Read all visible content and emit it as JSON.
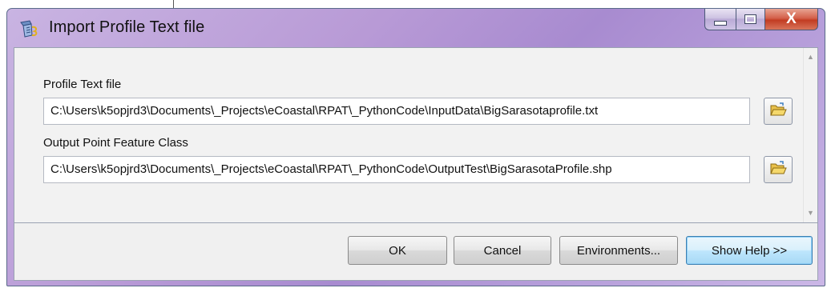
{
  "window": {
    "title": "Import Profile Text file",
    "icon": "python-script-tool-icon"
  },
  "caption": {
    "minimize_icon": "minimize-icon",
    "maximize_icon": "maximize-icon",
    "close_glyph": "X"
  },
  "form": {
    "profile_text_file": {
      "label": "Profile Text file",
      "value": "C:\\Users\\k5opjrd3\\Documents\\_Projects\\eCoastal\\RPAT\\_PythonCode\\InputData\\BigSarasotaprofile.txt",
      "browse_icon": "open-folder-icon"
    },
    "output_point_feature_class": {
      "label": "Output Point Feature Class",
      "value": "C:\\Users\\k5opjrd3\\Documents\\_Projects\\eCoastal\\RPAT\\_PythonCode\\OutputTest\\BigSarasotaProfile.shp",
      "browse_icon": "open-folder-icon"
    }
  },
  "buttons": {
    "ok": "OK",
    "cancel": "Cancel",
    "environments": "Environments...",
    "show_help": "Show Help >>"
  },
  "colors": {
    "title_bar": "#b89ad6",
    "close_button": "#c23c22",
    "focused_button_border": "#3c7fb1"
  }
}
